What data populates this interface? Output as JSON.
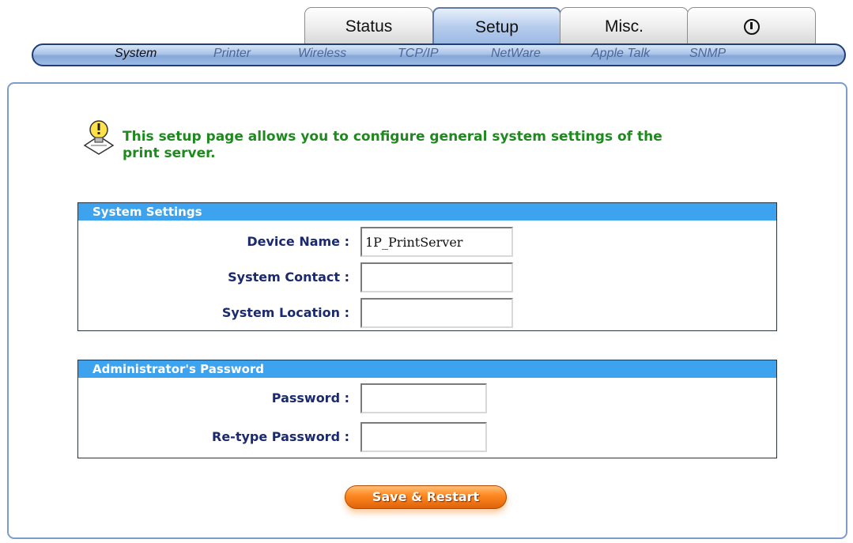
{
  "tabs": [
    {
      "label": "Status"
    },
    {
      "label": "Setup"
    },
    {
      "label": "Misc."
    },
    {
      "label": "",
      "icon": "power-icon"
    }
  ],
  "subnav": [
    "System",
    "Printer",
    "Wireless",
    "TCP/IP",
    "NetWare",
    "Apple Talk",
    "SNMP"
  ],
  "active_subnav": "System",
  "info": {
    "icon": "lightbulb-tip-icon",
    "text_line1": "This setup page allows you to configure general system settings of the",
    "text_line2": "print server."
  },
  "system_settings": {
    "title": "System Settings",
    "device_name_label": "Device Name :",
    "device_name_value": "1P_PrintServer",
    "system_contact_label": "System Contact :",
    "system_contact_value": "",
    "system_location_label": "System Location :",
    "system_location_value": ""
  },
  "admin_password": {
    "title": "Administrator's Password",
    "password_label": "Password :",
    "password_value": "",
    "retype_label": "Re-type Password :",
    "retype_value": ""
  },
  "save_button": "Save & Restart",
  "colors": {
    "section_header": "#3da3ee",
    "label_text": "#1b2a6e",
    "info_text": "#1e8a1e",
    "button": "#ff8a22"
  }
}
